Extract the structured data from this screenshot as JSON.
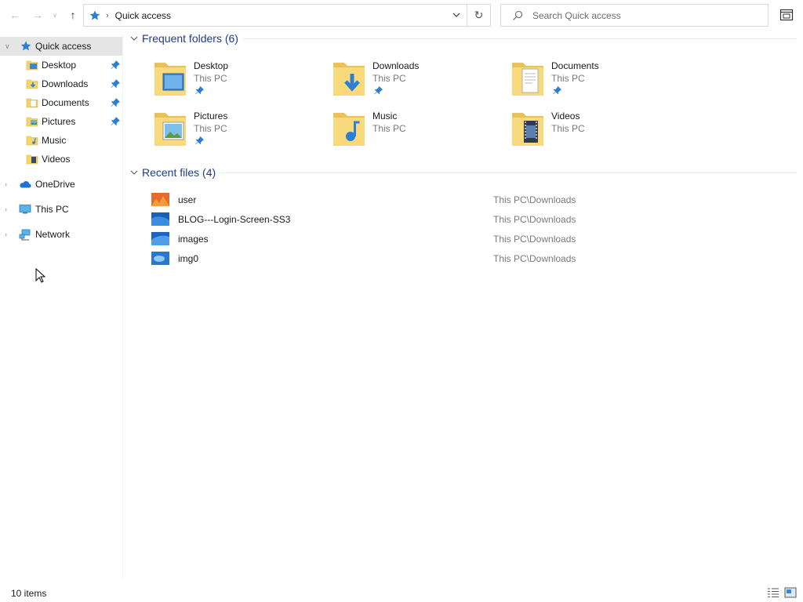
{
  "window": {
    "location": "Quick access",
    "search_placeholder": "Search Quick access"
  },
  "sidebar": {
    "quick_access": "Quick access",
    "pinned": [
      {
        "label": "Desktop",
        "pinned": true,
        "icon": "desktop-folder-icon"
      },
      {
        "label": "Downloads",
        "pinned": true,
        "icon": "downloads-folder-icon"
      },
      {
        "label": "Documents",
        "pinned": true,
        "icon": "documents-folder-icon"
      },
      {
        "label": "Pictures",
        "pinned": true,
        "icon": "pictures-folder-icon"
      },
      {
        "label": "Music",
        "pinned": false,
        "icon": "music-folder-icon"
      },
      {
        "label": "Videos",
        "pinned": false,
        "icon": "videos-folder-icon"
      }
    ],
    "onedrive": "OneDrive",
    "this_pc": "This PC",
    "network": "Network"
  },
  "frequent_folders": {
    "title": "Frequent folders (6)",
    "items": [
      {
        "name": "Desktop",
        "location": "This PC",
        "pinned": true,
        "overlay": "desktop"
      },
      {
        "name": "Downloads",
        "location": "This PC",
        "pinned": true,
        "overlay": "downloads"
      },
      {
        "name": "Documents",
        "location": "This PC",
        "pinned": true,
        "overlay": "documents"
      },
      {
        "name": "Pictures",
        "location": "This PC",
        "pinned": true,
        "overlay": "pictures"
      },
      {
        "name": "Music",
        "location": "This PC",
        "pinned": false,
        "overlay": "music"
      },
      {
        "name": "Videos",
        "location": "This PC",
        "pinned": false,
        "overlay": "videos"
      }
    ]
  },
  "recent_files": {
    "title": "Recent files (4)",
    "items": [
      {
        "name": "user",
        "path": "This PC\\Downloads"
      },
      {
        "name": "BLOG---Login-Screen-SS3",
        "path": "This PC\\Downloads"
      },
      {
        "name": "images",
        "path": "This PC\\Downloads"
      },
      {
        "name": "img0",
        "path": "This PC\\Downloads"
      }
    ]
  },
  "status": {
    "item_count": "10 items"
  },
  "colors": {
    "group_header": "#1e3c8c",
    "selection": "#e5e5e5",
    "folder_yellow": "#f5d56a",
    "accent_blue": "#2b7fd4"
  }
}
